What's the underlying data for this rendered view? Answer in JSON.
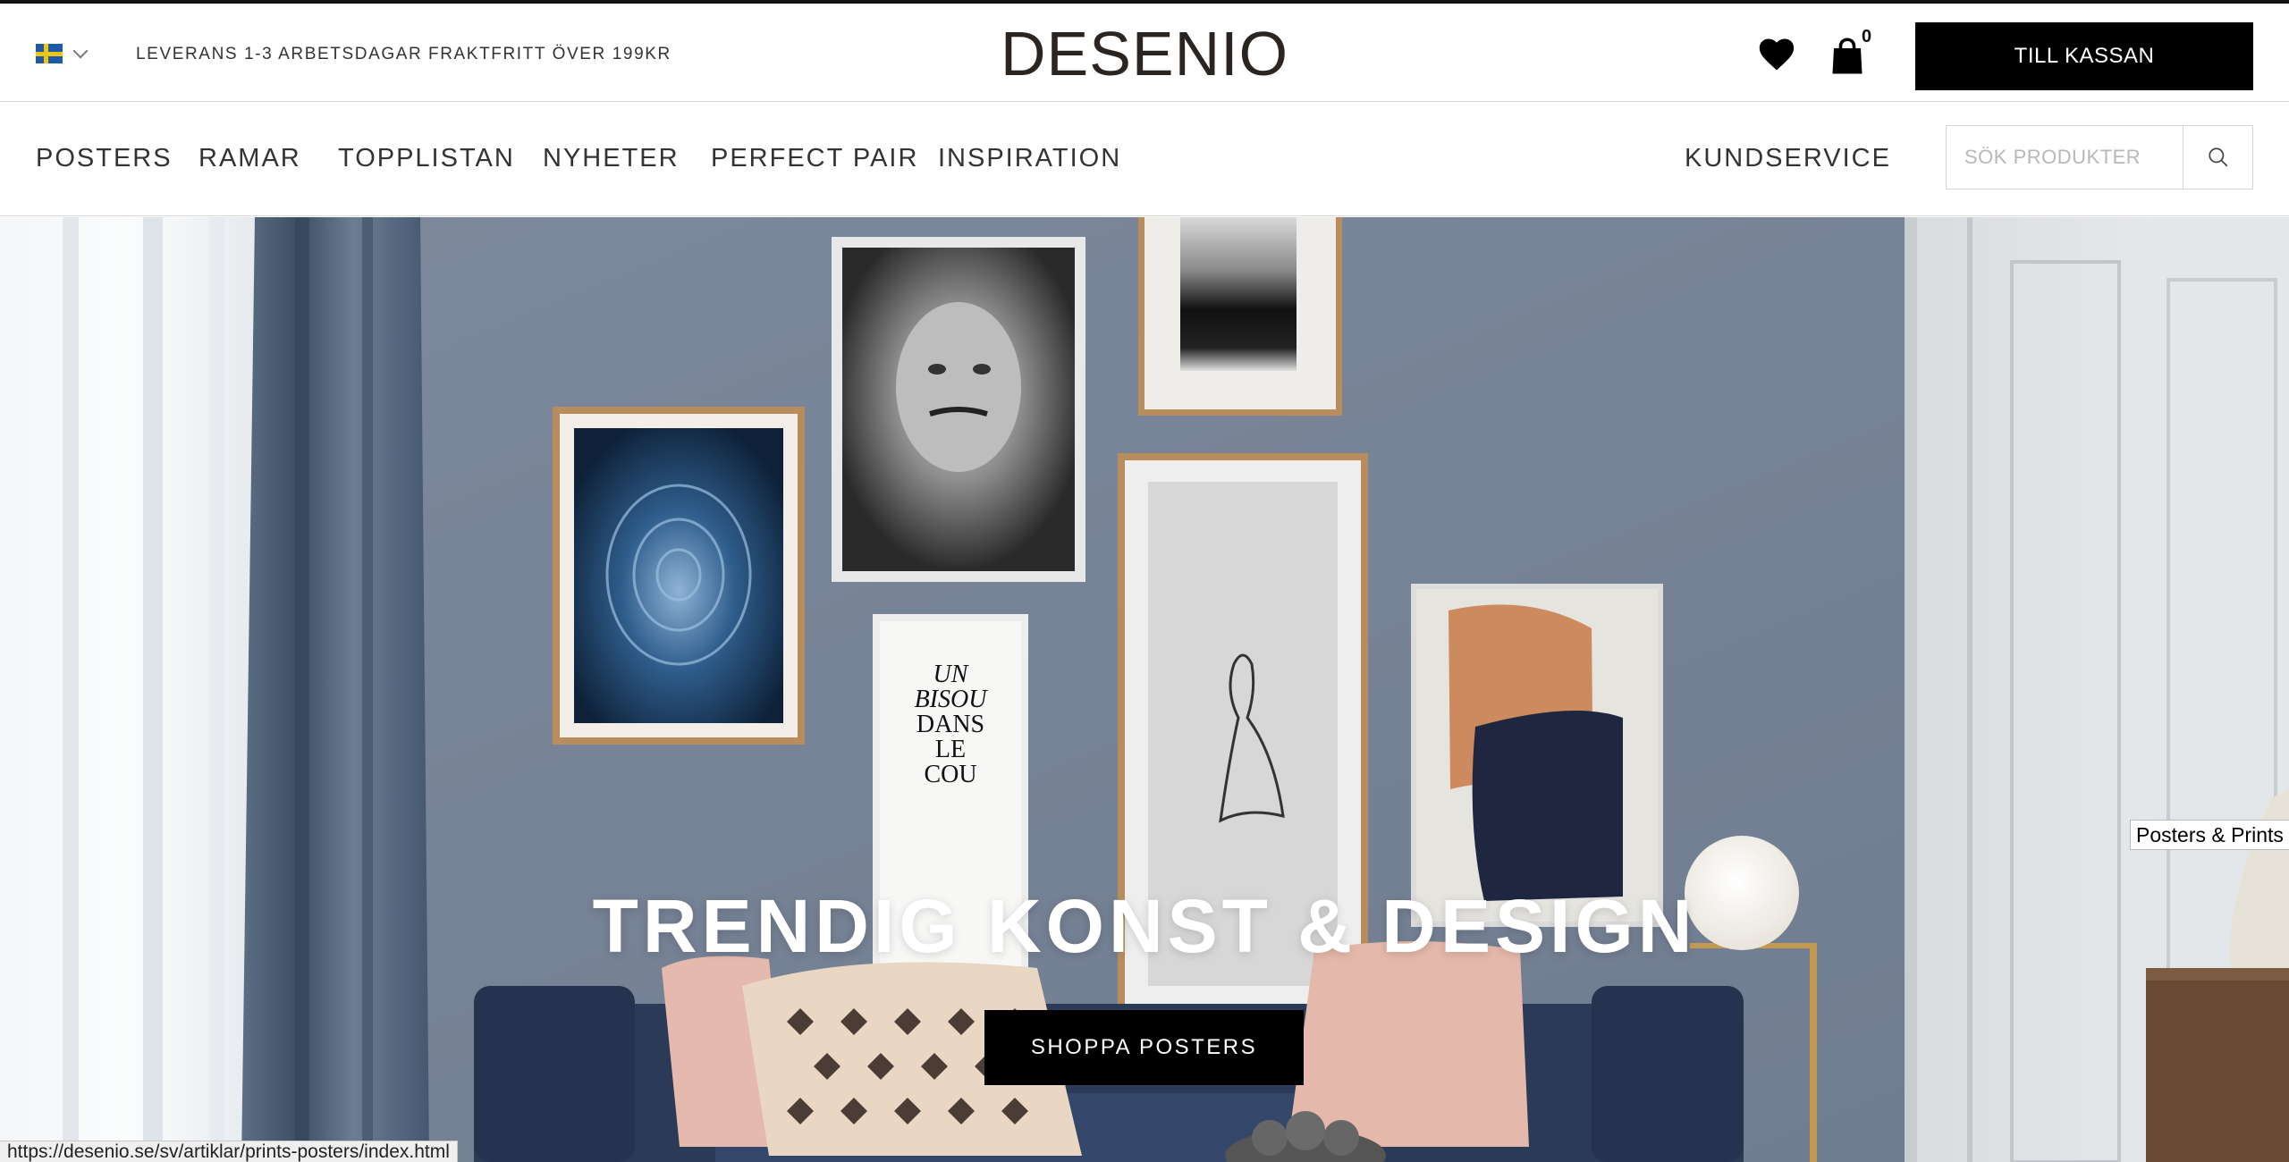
{
  "topbar": {
    "language_icon": "sweden-flag-icon",
    "usp_delivery": "LEVERANS 1-3 ARBETSDAGAR",
    "usp_shipping": "FRAKTFRITT ÖVER 199KR",
    "logo": "DESENIO",
    "wishlist_icon": "heart-icon",
    "cart_icon": "shopping-bag-icon",
    "cart_count": "0",
    "checkout_label": "TILL KASSAN"
  },
  "nav": {
    "items": [
      {
        "label": "POSTERS"
      },
      {
        "label": "RAMAR"
      },
      {
        "label": "TOPPLISTAN"
      },
      {
        "label": "NYHETER"
      },
      {
        "label": "PERFECT PAIR"
      },
      {
        "label": "INSPIRATION"
      }
    ],
    "customer_service": "KUNDSERVICE",
    "search_placeholder": "SÖK PRODUKTER",
    "search_icon": "search-icon"
  },
  "hero": {
    "title": "TRENDIG KONST & DESIGN",
    "cta_label": "SHOPPA POSTERS",
    "poster_text": [
      "UN",
      "BISOU",
      "DANS",
      "LE",
      "COU"
    ]
  },
  "tooltip": "Posters & Prints",
  "status_url": "https://desenio.se/sv/artiklar/prints-posters/index.html",
  "colors": {
    "wall": "#7a8699",
    "checkout_bg": "#000000",
    "sofa": "#2b3a56",
    "pillow_pink": "#e6b9ae",
    "brass": "#c49a52"
  }
}
